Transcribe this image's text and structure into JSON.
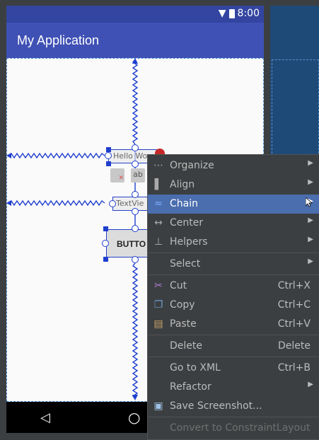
{
  "status_bar": {
    "time": "8:00"
  },
  "app": {
    "title": "My Application"
  },
  "widgets": {
    "text_top": "Hello Wo",
    "text_mid": "TextVie",
    "button": "BUTTO",
    "ab_label": "ab"
  },
  "context_menu": {
    "items": [
      {
        "label": "Organize",
        "icon": "organize-icon",
        "submenu": true
      },
      {
        "label": "Align",
        "icon": "align-icon",
        "submenu": true
      },
      {
        "label": "Chain",
        "icon": "chain-icon",
        "submenu": true,
        "selected": true
      },
      {
        "label": "Center",
        "icon": "center-icon",
        "submenu": true
      },
      {
        "label": "Helpers",
        "icon": "helpers-icon",
        "submenu": true
      },
      {
        "label": "Select",
        "submenu": true
      },
      {
        "label": "Cut",
        "icon": "scissors-icon",
        "shortcut": "Ctrl+X"
      },
      {
        "label": "Copy",
        "icon": "copy-icon",
        "shortcut": "Ctrl+C"
      },
      {
        "label": "Paste",
        "icon": "paste-icon",
        "shortcut": "Ctrl+V"
      },
      {
        "label": "Delete",
        "shortcut": "Delete"
      },
      {
        "label": "Go to XML",
        "shortcut": "Ctrl+B"
      },
      {
        "label": "Refactor",
        "submenu": true
      },
      {
        "label": "Save Screenshot...",
        "icon": "camera-icon"
      },
      {
        "label": "Convert to ConstraintLayout",
        "disabled": true
      }
    ]
  },
  "colors": {
    "accent": "#4b6eaf",
    "app_bar": "#3f51b5",
    "status_bar": "#3345a0",
    "constraint": "#1f3fcf"
  }
}
